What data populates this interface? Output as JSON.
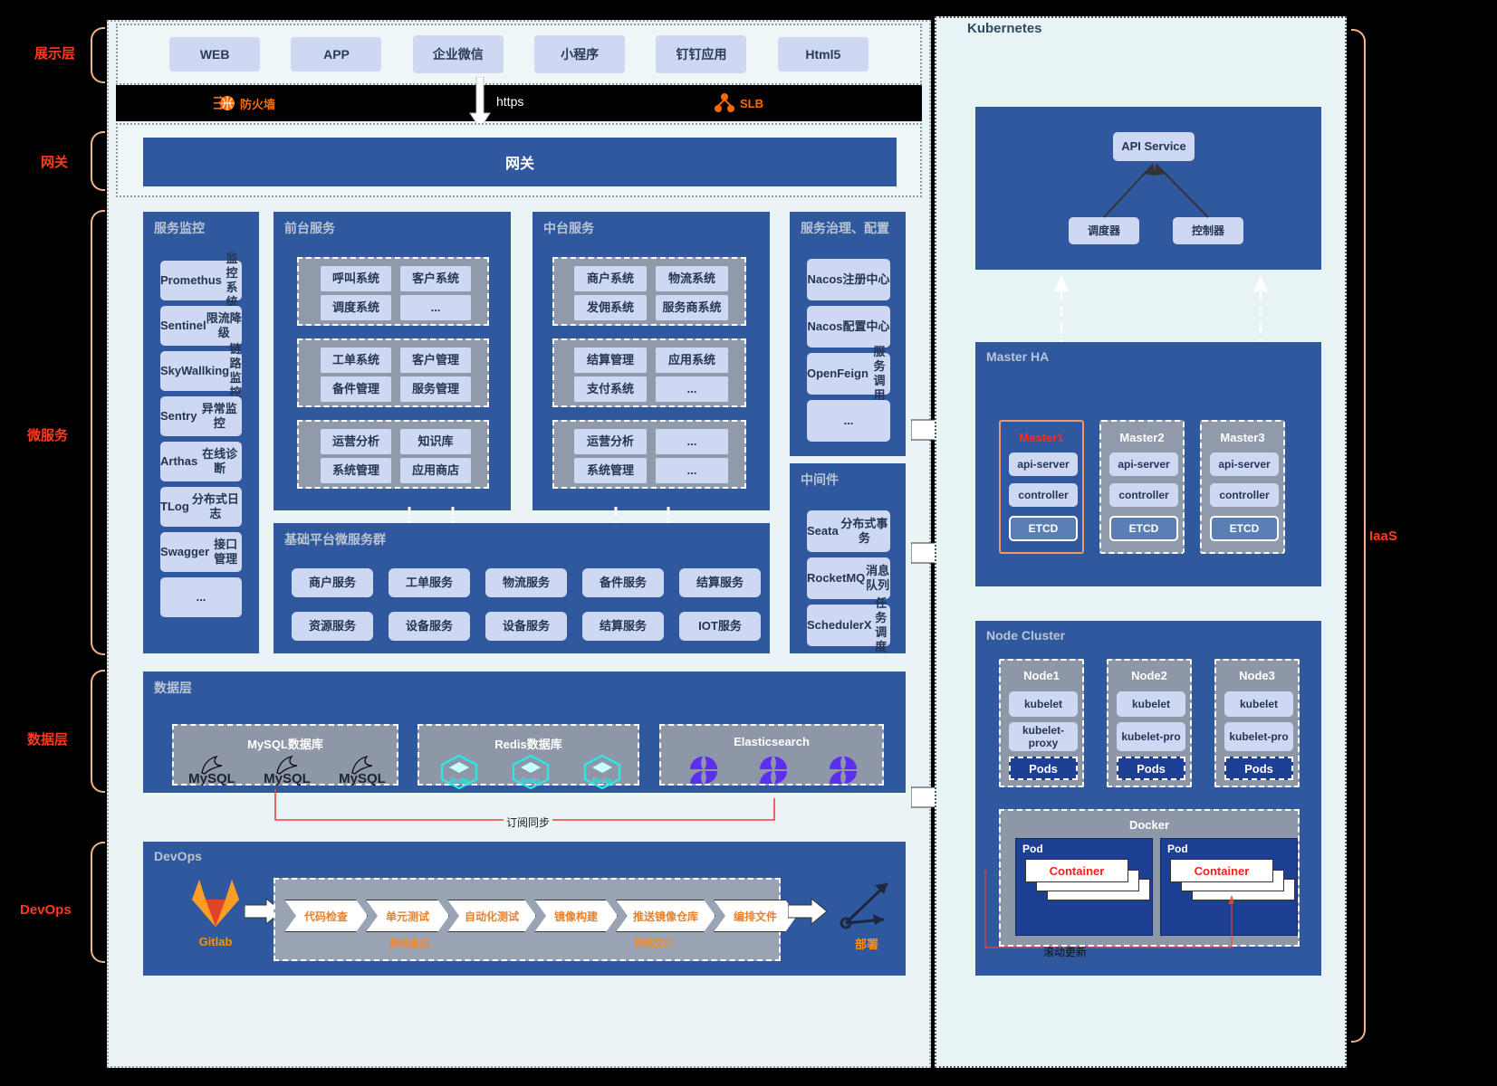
{
  "edge_labels": {
    "presentation": "展示层",
    "gateway": "网关",
    "microservice": "微服务",
    "data": "数据层",
    "devops": "DevOps",
    "iaas": "IaaS"
  },
  "presentation": {
    "items": [
      "WEB",
      "APP",
      "企业微信",
      "小程序",
      "钉钉应用",
      "Html5"
    ]
  },
  "band": {
    "firewall": "防火墙",
    "slb": "SLB",
    "https": "https"
  },
  "gateway": {
    "label": "网关"
  },
  "service_monitor": {
    "title": "服务监控",
    "items": [
      "Promethus\n监控系统",
      "Sentinel\n限流降级",
      "SkyWallking\n链路监控",
      "Sentry\n异常监控",
      "Arthas\n在线诊断",
      "TLog\n分布式日志",
      "Swagger\n接口管理",
      "..."
    ]
  },
  "front_service": {
    "title": "前台服务",
    "groups": [
      {
        "left": [
          "呼叫系统",
          "调度系统"
        ],
        "right": [
          "客户系统",
          "..."
        ]
      },
      {
        "left": [
          "工单系统",
          "备件管理"
        ],
        "right": [
          "客户管理",
          "服务管理"
        ]
      },
      {
        "left": [
          "运营分析",
          "系统管理"
        ],
        "right": [
          "知识库",
          "应用商店"
        ]
      }
    ]
  },
  "middle_service": {
    "title": "中台服务",
    "groups": [
      {
        "left": [
          "商户系统",
          "发佣系统"
        ],
        "right": [
          "物流系统",
          "服务商系统"
        ]
      },
      {
        "left": [
          "结算管理",
          "支付系统"
        ],
        "right": [
          "应用系统",
          "..."
        ]
      },
      {
        "left": [
          "运营分析",
          "系统管理"
        ],
        "right": [
          "...",
          "..."
        ]
      }
    ]
  },
  "governance": {
    "title": "服务治理、配置",
    "items": [
      "Nacos\n注册中心",
      "Nacos\n配置中心",
      "OpenFeign\n服务调用",
      "..."
    ]
  },
  "middleware": {
    "title": "中间件",
    "items": [
      "Seata\n分布式事务",
      "RocketMQ\n消息队列",
      "SchedulerX\n任务调度"
    ]
  },
  "platform_micro": {
    "title": "基础平台微服务群",
    "row1": [
      "商户服务",
      "工单服务",
      "物流服务",
      "备件服务",
      "结算服务"
    ],
    "row2": [
      "资源服务",
      "设备服务",
      "设备服务",
      "结算服务",
      "IOT服务"
    ]
  },
  "data_layer": {
    "title": "数据层",
    "mysql": {
      "title": "MySQL数据库",
      "nodes": [
        "MySQL",
        "MySQL",
        "MySQL"
      ]
    },
    "redis": {
      "title": "Redis数据库",
      "nodes": [
        "Redis",
        "Redis",
        "Redis"
      ]
    },
    "es": {
      "title": "Elasticsearch",
      "nodes": [
        "",
        "",
        ""
      ]
    },
    "sync_label": "订阅同步"
  },
  "devops": {
    "title": "DevOps",
    "gitlab": "Gitlab",
    "stages": [
      "代码检查",
      "单元测试",
      "自动化测试",
      "镜像构建",
      "推送镜像仓库",
      "编排文件"
    ],
    "sub_labels": [
      "持续集成",
      "持续交付"
    ],
    "deploy": "部署"
  },
  "kubernetes": {
    "title": "Kubernetes",
    "control_plane": {
      "api": "API Service",
      "scheduler": "调度器",
      "controller": "控制器"
    },
    "master_ha": {
      "title": "Master HA",
      "masters": [
        {
          "name": "Master1",
          "api": "api-server",
          "controller": "controller",
          "etcd": "ETCD",
          "active": true
        },
        {
          "name": "Master2",
          "api": "api-server",
          "controller": "controller",
          "etcd": "ETCD",
          "active": false
        },
        {
          "name": "Master3",
          "api": "api-server",
          "controller": "controller",
          "etcd": "ETCD",
          "active": false
        }
      ]
    },
    "node_cluster": {
      "title": "Node Cluster",
      "nodes": [
        {
          "name": "Node1",
          "kubelet": "kubelet",
          "proxy": "kubelet-proxy",
          "pods": "Pods"
        },
        {
          "name": "Node2",
          "kubelet": "kubelet",
          "proxy": "kubelet-pro",
          "pods": "Pods"
        },
        {
          "name": "Node3",
          "kubelet": "kubelet",
          "proxy": "kubelet-pro",
          "pods": "Pods"
        }
      ]
    },
    "docker": {
      "title": "Docker",
      "pods": [
        {
          "label": "Pod",
          "container": "Container"
        },
        {
          "label": "Pod",
          "container": "Container"
        }
      ],
      "rolling_update": "滚动更新"
    }
  },
  "colors": {
    "blue": "#30589f",
    "chip": "#ced8f2",
    "gray": "#919aab",
    "orange": "#ff6a00",
    "red": "#ff3b1f"
  }
}
